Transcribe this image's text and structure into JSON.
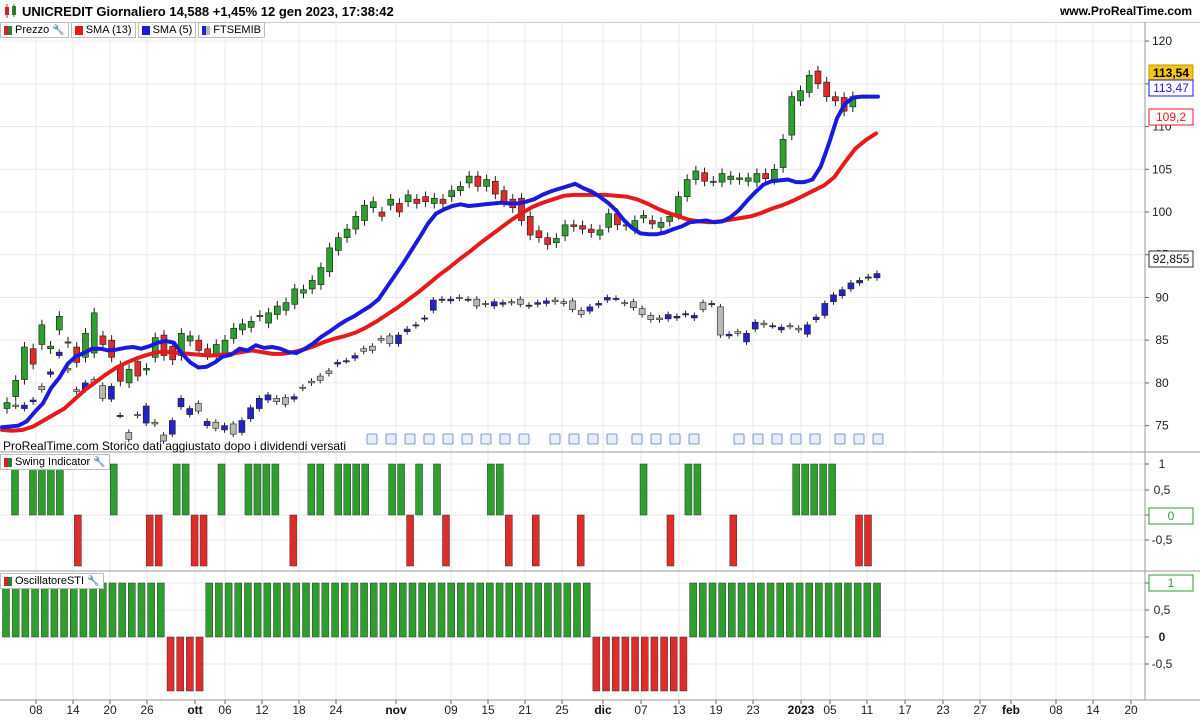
{
  "header": {
    "title": "UNICREDIT Giornaliero 14,588 +1,45% 12 gen 2023, 17:38:42",
    "site": "www.ProRealTime.com"
  },
  "legend": [
    {
      "label": "Prezzo",
      "color": "#2e7d32",
      "icon": "candles-icon",
      "has_wrench": true
    },
    {
      "label": "SMA (13)",
      "color": "#e41a1c",
      "icon": "line-icon",
      "has_wrench": false
    },
    {
      "label": "SMA (5)",
      "color": "#1a1adc",
      "icon": "line-icon",
      "has_wrench": false
    },
    {
      "label": "FTSEMIB",
      "color": "#2323c8",
      "icon": "bars-icon",
      "has_wrench": false
    }
  ],
  "footnote": "ProRealTime.com Storico dati aggiustato dopo i dividendi versati",
  "colors": {
    "up": "#2e9e2e",
    "down": "#e02b2b",
    "sma13": "#e41a1c",
    "sma5": "#1a1adc",
    "ftse_up": "#2323c8",
    "ftse_down": "#b8b8b8",
    "grid": "#e9e9e9"
  },
  "chart_data": [
    {
      "type": "candlestick",
      "title": "UNICREDIT Giornaliero",
      "x_labels": [
        "08",
        "14",
        "20",
        "26",
        "ott",
        "06",
        "12",
        "18",
        "24",
        "nov",
        "09",
        "15",
        "21",
        "25",
        "dic",
        "07",
        "13",
        "19",
        "23",
        "2023",
        "05",
        "11",
        "17",
        "23",
        "27",
        "feb",
        "08",
        "14",
        "20"
      ],
      "bold_labels": [
        "ott",
        "nov",
        "dic",
        "2023",
        "feb"
      ],
      "y_ticks": [
        75,
        80,
        85,
        90,
        95,
        100,
        105,
        110,
        115,
        120
      ],
      "ylim": [
        72.5,
        122
      ],
      "price_labels": {
        "last": "113,54",
        "sma5": "113,47",
        "sma13": "109,2",
        "index": "92,855"
      },
      "candles": [
        [
          77.0,
          77.7
        ],
        [
          78.4,
          80.3
        ],
        [
          80.4,
          84.2
        ],
        [
          84.0,
          82.2
        ],
        [
          84.5,
          86.8
        ],
        [
          84.0,
          84.3
        ],
        [
          86.2,
          87.8
        ],
        [
          84.8,
          84.7
        ],
        [
          84.2,
          82.4
        ],
        [
          83.0,
          85.8
        ],
        [
          83.5,
          88.2
        ],
        [
          85.5,
          84.5
        ],
        [
          85.0,
          83.0
        ],
        [
          82.0,
          80.2
        ],
        [
          80.0,
          81.6
        ],
        [
          82.5,
          80.8
        ],
        [
          81.5,
          81.7
        ],
        [
          83.0,
          85.3
        ],
        [
          85.6,
          83.2
        ],
        [
          84.3,
          82.7
        ],
        [
          83.2,
          85.8
        ],
        [
          84.9,
          85.5
        ],
        [
          85.0,
          83.8
        ],
        [
          84.0,
          83.3
        ],
        [
          83.1,
          84.5
        ],
        [
          83.5,
          85.0
        ],
        [
          85.2,
          86.4
        ],
        [
          86.2,
          86.9
        ],
        [
          86.5,
          87.2
        ],
        [
          87.8,
          87.9
        ],
        [
          87.0,
          88.2
        ],
        [
          88.0,
          89.0
        ],
        [
          88.5,
          89.4
        ],
        [
          89.2,
          91.0
        ],
        [
          90.5,
          90.9
        ],
        [
          91.0,
          92.0
        ],
        [
          91.5,
          93.5
        ],
        [
          93.0,
          95.8
        ],
        [
          95.5,
          97.0
        ],
        [
          97.0,
          98.0
        ],
        [
          98.0,
          99.5
        ],
        [
          99.0,
          100.8
        ],
        [
          100.5,
          101.2
        ],
        [
          100.0,
          99.5
        ],
        [
          100.8,
          101.5
        ],
        [
          101.0,
          100.0
        ],
        [
          101.2,
          102.0
        ],
        [
          101.5,
          101.0
        ],
        [
          101.8,
          101.2
        ],
        [
          101.0,
          101.6
        ],
        [
          101.5,
          101.0
        ],
        [
          101.8,
          102.5
        ],
        [
          102.5,
          103.0
        ],
        [
          103.4,
          104.2
        ],
        [
          104.2,
          103.0
        ],
        [
          103.0,
          103.8
        ],
        [
          103.6,
          102.1
        ],
        [
          102.5,
          101.2
        ],
        [
          101.5,
          100.5
        ],
        [
          101.6,
          99.0
        ],
        [
          99.5,
          97.3
        ],
        [
          97.8,
          97.0
        ],
        [
          97.0,
          96.2
        ],
        [
          96.4,
          96.9
        ],
        [
          97.2,
          98.5
        ],
        [
          98.5,
          98.3
        ],
        [
          98.4,
          98.0
        ],
        [
          98.0,
          97.6
        ],
        [
          97.3,
          97.9
        ],
        [
          98.2,
          99.8
        ],
        [
          99.8,
          98.5
        ],
        [
          98.5,
          98.4
        ],
        [
          98.0,
          99.0
        ],
        [
          99.3,
          99.6
        ],
        [
          99.0,
          98.6
        ],
        [
          98.2,
          98.8
        ],
        [
          98.9,
          99.5
        ],
        [
          99.7,
          101.8
        ],
        [
          101.8,
          103.8
        ],
        [
          103.8,
          104.8
        ],
        [
          104.6,
          103.6
        ],
        [
          103.6,
          103.6
        ],
        [
          103.5,
          104.5
        ],
        [
          103.8,
          104.2
        ],
        [
          103.8,
          104.0
        ],
        [
          103.6,
          104.0
        ],
        [
          103.5,
          104.5
        ],
        [
          104.5,
          103.9
        ],
        [
          103.8,
          105.0
        ],
        [
          105.2,
          108.5
        ],
        [
          109.0,
          113.5
        ],
        [
          113.0,
          114.2
        ],
        [
          114.0,
          116.0
        ],
        [
          116.5,
          115.0
        ],
        [
          115.2,
          113.5
        ],
        [
          113.5,
          113.0
        ],
        [
          113.4,
          111.8
        ],
        [
          112.3,
          113.5
        ]
      ],
      "index_bars": [
        [
          77.5,
          77.6
        ],
        [
          77.4,
          77.3
        ],
        [
          77.0,
          77.4
        ],
        [
          77.8,
          78.0
        ],
        [
          79.6,
          79.2
        ],
        [
          81.0,
          81.3
        ],
        [
          83.2,
          83.6
        ],
        [
          81.7,
          81.5
        ],
        [
          79.2,
          79.0
        ],
        [
          79.2,
          80.0
        ],
        [
          80.4,
          80.0
        ],
        [
          79.7,
          78.2
        ],
        [
          78.1,
          79.6
        ],
        [
          76.2,
          76.2
        ],
        [
          74.2,
          73.4
        ],
        [
          76.3,
          76.2
        ],
        [
          75.3,
          77.3
        ],
        [
          75.4,
          75.2
        ],
        [
          73.9,
          73.2
        ],
        [
          74.0,
          75.6
        ],
        [
          77.2,
          78.2
        ],
        [
          76.3,
          77.0
        ],
        [
          77.6,
          76.7
        ],
        [
          75.0,
          75.5
        ],
        [
          75.4,
          74.7
        ],
        [
          74.5,
          75.0
        ],
        [
          75.2,
          74.0
        ],
        [
          74.2,
          75.6
        ],
        [
          75.8,
          77.1
        ],
        [
          77.0,
          78.2
        ],
        [
          78.0,
          78.6
        ],
        [
          78.2,
          77.8
        ],
        [
          78.3,
          77.5
        ],
        [
          78.1,
          78.4
        ],
        [
          79.5,
          79.4
        ],
        [
          80.2,
          80.0
        ],
        [
          80.8,
          80.3
        ],
        [
          81.4,
          81.1
        ],
        [
          82.2,
          82.4
        ],
        [
          82.6,
          82.6
        ],
        [
          82.9,
          83.2
        ],
        [
          84.0,
          83.7
        ],
        [
          84.3,
          83.8
        ],
        [
          85.2,
          85.0
        ],
        [
          85.5,
          84.6
        ],
        [
          84.6,
          85.6
        ],
        [
          86.0,
          86.3
        ],
        [
          86.7,
          86.8
        ],
        [
          87.5,
          87.6
        ],
        [
          88.5,
          89.7
        ],
        [
          89.7,
          89.8
        ],
        [
          89.6,
          89.8
        ],
        [
          90.0,
          89.9
        ],
        [
          89.8,
          89.8
        ],
        [
          89.8,
          89.0
        ],
        [
          89.3,
          89.2
        ],
        [
          89.0,
          89.5
        ],
        [
          89.2,
          89.4
        ],
        [
          89.5,
          89.4
        ],
        [
          89.8,
          89.2
        ],
        [
          89.0,
          89.1
        ],
        [
          89.2,
          89.4
        ],
        [
          89.3,
          89.6
        ],
        [
          89.7,
          89.5
        ],
        [
          89.5,
          89.3
        ],
        [
          89.6,
          88.6
        ],
        [
          88.5,
          88.0
        ],
        [
          88.4,
          88.9
        ],
        [
          89.1,
          89.3
        ],
        [
          89.7,
          90.0
        ],
        [
          89.9,
          89.9
        ],
        [
          89.4,
          89.3
        ],
        [
          89.5,
          88.8
        ],
        [
          88.7,
          88.0
        ],
        [
          87.9,
          87.4
        ],
        [
          87.6,
          87.4
        ],
        [
          87.5,
          88.0
        ],
        [
          87.6,
          87.8
        ],
        [
          88.0,
          88.1
        ],
        [
          87.6,
          87.9
        ],
        [
          89.4,
          88.6
        ],
        [
          89.2,
          89.3
        ],
        [
          88.9,
          85.6
        ],
        [
          85.5,
          85.7
        ],
        [
          86.0,
          85.8
        ],
        [
          84.8,
          85.8
        ],
        [
          86.3,
          87.1
        ],
        [
          87.0,
          86.8
        ],
        [
          86.7,
          86.7
        ],
        [
          86.2,
          86.5
        ],
        [
          86.7,
          86.6
        ],
        [
          86.4,
          86.2
        ],
        [
          85.7,
          86.8
        ],
        [
          87.4,
          87.7
        ],
        [
          87.9,
          89.3
        ],
        [
          89.5,
          90.3
        ],
        [
          90.2,
          90.9
        ],
        [
          91.0,
          91.7
        ],
        [
          91.7,
          92.0
        ],
        [
          92.3,
          92.4
        ],
        [
          92.3,
          92.8
        ]
      ],
      "sma5": [
        74.8,
        74.9,
        75.0,
        75.5,
        76.6,
        77.6,
        79.4,
        80.6,
        82.2,
        83.1,
        83.5,
        84.0,
        84.0,
        83.8,
        83.9,
        84.1,
        84.2,
        84.0,
        84.3,
        84.7,
        84.9,
        84.7,
        83.4,
        82.4,
        81.8,
        81.9,
        82.4,
        83.1,
        83.3,
        84.0,
        83.8,
        84.4,
        84.1,
        84.2,
        84.0,
        83.6,
        83.5,
        84.0,
        84.6,
        85.4,
        86.0,
        86.7,
        87.3,
        87.8,
        88.4,
        89.0,
        89.8,
        91.2,
        92.6,
        94.0,
        95.5,
        97.0,
        98.6,
        99.8,
        100.3,
        100.7,
        100.9,
        100.7,
        100.8,
        100.9,
        101.0,
        101.1,
        101.0,
        101.0,
        101.2,
        101.5,
        102.0,
        102.4,
        102.7,
        103.0,
        103.3,
        102.8,
        102.4,
        101.8,
        101.1,
        100.2,
        99.0,
        98.1,
        97.5,
        97.4,
        97.4,
        97.6,
        98.0,
        98.3,
        98.8,
        98.9,
        99.0,
        98.8,
        98.9,
        99.4,
        100.2,
        101.3,
        102.3,
        103.2,
        103.6,
        103.7,
        103.8,
        103.5,
        103.5,
        103.8,
        105.3,
        108.0,
        111.0,
        112.7,
        113.4,
        113.5,
        113.5,
        113.5
      ],
      "sma13": [
        74.5,
        74.4,
        74.5,
        74.9,
        75.6,
        76.3,
        77.0,
        78.1,
        79.2,
        80.1,
        81.0,
        81.8,
        82.4,
        82.9,
        83.3,
        83.6,
        83.6,
        83.5,
        83.4,
        83.3,
        83.2,
        83.3,
        83.4,
        83.6,
        83.8,
        83.6,
        83.4,
        83.4,
        83.6,
        83.9,
        84.3,
        84.8,
        85.2,
        85.5,
        85.9,
        86.5,
        87.2,
        88.0,
        88.8,
        89.7,
        90.6,
        91.6,
        92.6,
        93.5,
        94.5,
        95.4,
        96.4,
        97.3,
        98.2,
        99.1,
        99.9,
        100.6,
        101.1,
        101.5,
        101.9,
        102.0,
        102.0,
        102.0,
        102.0,
        101.9,
        101.8,
        101.5,
        101.0,
        100.4,
        99.9,
        99.5,
        99.1,
        98.9,
        98.8,
        98.9,
        99.1,
        99.3,
        99.5,
        99.9,
        100.4,
        100.8,
        101.3,
        101.9,
        102.5,
        103.1,
        104.1,
        105.8,
        107.4,
        108.4,
        109.2
      ],
      "series": [
        {
          "name": "Prezzo"
        },
        {
          "name": "SMA (13)"
        },
        {
          "name": "SMA (5)"
        },
        {
          "name": "FTSEMIB"
        }
      ]
    },
    {
      "type": "bar",
      "title": "Swing Indicator",
      "y_ticks": [
        "1",
        "0,5",
        "0",
        "-0,5"
      ],
      "last_value_label": "0",
      "values": [
        1,
        0,
        1,
        1,
        1,
        1,
        0,
        -1,
        0,
        0,
        0,
        1,
        0,
        0,
        0,
        -1,
        -1,
        0,
        1,
        1,
        -1,
        -1,
        0,
        1,
        0,
        0,
        1,
        1,
        1,
        1,
        0,
        -1,
        0,
        1,
        1,
        0,
        1,
        1,
        1,
        1,
        0,
        0,
        1,
        1,
        -1,
        1,
        0,
        1,
        -1,
        0,
        0,
        0,
        0,
        1,
        1,
        -1,
        0,
        0,
        -1,
        0,
        0,
        0,
        0,
        -1,
        0,
        0,
        0,
        0,
        0,
        0,
        1,
        0,
        0,
        -1,
        0,
        1,
        1,
        0,
        0,
        0,
        -1,
        0,
        0,
        0,
        0,
        0,
        0,
        1,
        1,
        1,
        1,
        1,
        0,
        0,
        -1,
        -1
      ]
    },
    {
      "type": "bar",
      "title": "OscillatoreSTI",
      "y_ticks": [
        "1",
        "0,5",
        "0",
        "-0,5"
      ],
      "last_value_label": "1",
      "values": [
        1,
        1,
        1,
        1,
        1,
        1,
        1,
        1,
        1,
        1,
        1,
        1,
        1,
        1,
        1,
        1,
        1,
        -1,
        -1,
        -1,
        -1,
        1,
        1,
        1,
        1,
        1,
        1,
        1,
        1,
        1,
        1,
        1,
        1,
        1,
        1,
        1,
        1,
        1,
        1,
        1,
        1,
        1,
        1,
        1,
        1,
        1,
        1,
        1,
        1,
        1,
        1,
        1,
        1,
        1,
        1,
        1,
        1,
        1,
        1,
        1,
        1,
        -1,
        -1,
        -1,
        -1,
        -1,
        -1,
        -1,
        -1,
        -1,
        -1,
        1,
        1,
        1,
        1,
        1,
        1,
        1,
        1,
        1,
        1,
        1,
        1,
        1,
        1,
        1,
        1,
        1,
        1,
        1,
        1
      ]
    }
  ],
  "panels": {
    "swing_label": "Swing Indicator",
    "osc_label": "OscillatoreSTI"
  }
}
